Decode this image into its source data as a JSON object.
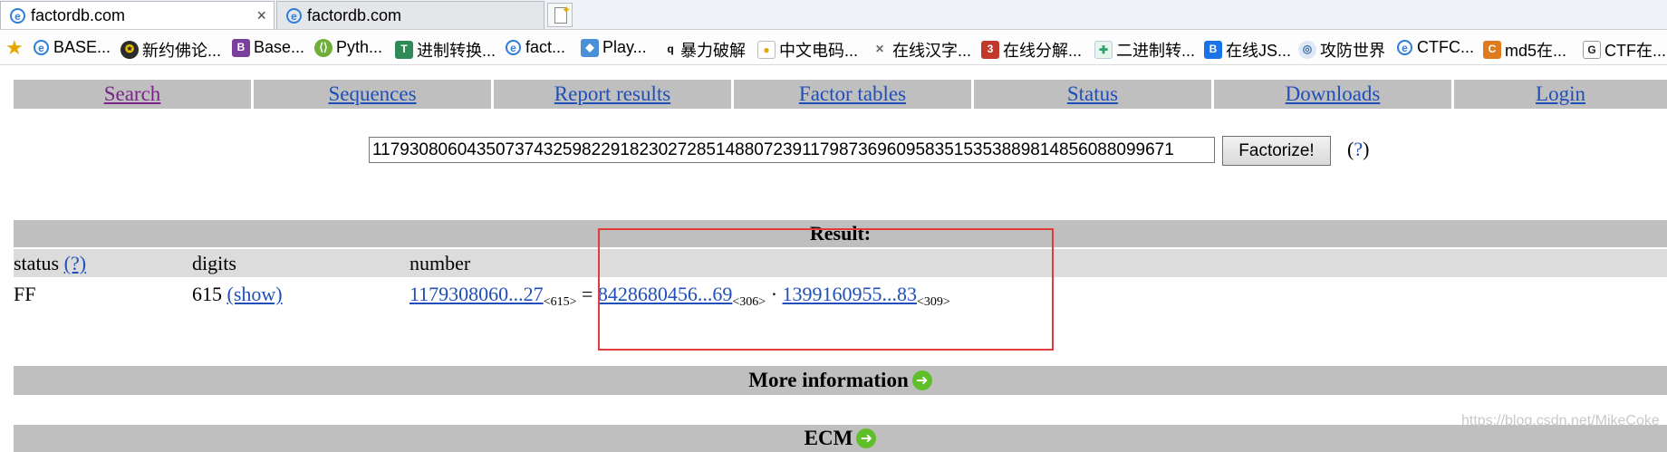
{
  "tabs": [
    {
      "title": "factordb.com",
      "active": true
    },
    {
      "title": "factordb.com",
      "active": false
    }
  ],
  "close_glyph": "×",
  "favorites": [
    {
      "label": "BASE...",
      "icon": "ie-icon"
    },
    {
      "label": "新约佛论...",
      "icon": "buddha-icon"
    },
    {
      "label": "Base...",
      "icon": "base-icon"
    },
    {
      "label": "Pyth...",
      "icon": "python-icon"
    },
    {
      "label": "进制转换...",
      "icon": "convert-icon"
    },
    {
      "label": "fact...",
      "icon": "ie-icon"
    },
    {
      "label": "Play...",
      "icon": "play-icon"
    },
    {
      "label": "暴力破解",
      "icon": "q-icon"
    },
    {
      "label": "中文电码...",
      "icon": "code-icon"
    },
    {
      "label": "在线汉字...",
      "icon": "hanzi-icon"
    },
    {
      "label": "在线分解...",
      "icon": "decompose-icon"
    },
    {
      "label": "二进制转...",
      "icon": "binary-icon"
    },
    {
      "label": "在线JS...",
      "icon": "js-icon"
    },
    {
      "label": "攻防世界",
      "icon": "attack-icon"
    },
    {
      "label": "CTFC...",
      "icon": "ie-icon"
    },
    {
      "label": "md5在...",
      "icon": "md5-icon"
    },
    {
      "label": "CTF在...",
      "icon": "ctf-icon"
    }
  ],
  "nav": [
    "Search",
    "Sequences",
    "Report results",
    "Factor tables",
    "Status",
    "Downloads",
    "Login"
  ],
  "query": {
    "value": "117930806043507374325982291823027285148807239117987369609583515353889814856088099671",
    "button": "Factorize!",
    "help": "(?)"
  },
  "result": {
    "title": "Result:",
    "headers": {
      "status": "status",
      "status_help": "(?)",
      "digits": "digits",
      "number": "number"
    },
    "row": {
      "status": "FF",
      "digits": "615",
      "show": "(show)",
      "number": "1179308060...27",
      "number_digits": "<615>",
      "equals": "=",
      "factor1": "8428680456...69",
      "factor1_digits": "<306>",
      "dot": "·",
      "factor2": "1399160955...83",
      "factor2_digits": "<309>"
    }
  },
  "more_information": "More information",
  "ecm": "ECM",
  "watermark": "https://blog.csdn.net/MikeCoke",
  "colors": {
    "link": "#1f4fb8",
    "visited": "#7a2488",
    "bar": "#bfbfbf",
    "highlight": "#e23b3b"
  }
}
